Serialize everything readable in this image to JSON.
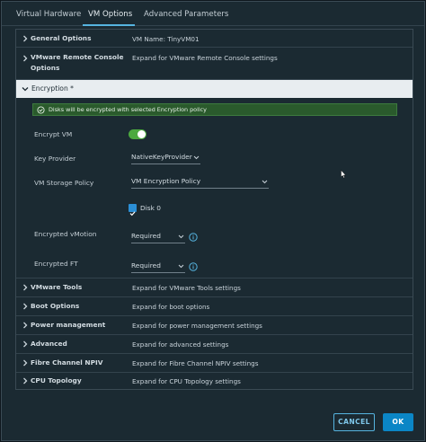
{
  "tabs": [
    {
      "label": "Virtual Hardware"
    },
    {
      "label": "VM Options"
    },
    {
      "label": "Advanced Parameters"
    }
  ],
  "active_tab": "VM Options",
  "colors": {
    "accent": "#56b4e0",
    "toggle_on": "#4ca93f",
    "success_bg": "#2a5a2c",
    "primary_button": "#0b86c6"
  },
  "rows_top": [
    {
      "label": "General Options",
      "value": "VM Name: TinyVM01"
    },
    {
      "label": "VMware Remote Console Options",
      "value": "Expand for VMware Remote Console settings"
    }
  ],
  "encryption": {
    "title": "Encryption *",
    "banner": "Disks will be encrypted with selected Encryption policy",
    "encrypt_vm_label": "Encrypt VM",
    "encrypt_vm_on": true,
    "key_provider_label": "Key Provider",
    "key_provider_value": "NativeKeyProvider",
    "storage_policy_label": "VM Storage Policy",
    "storage_policy_value": "VM Encryption Policy",
    "disk_label": "Disk 0",
    "disk_checked": true,
    "vmotion_label": "Encrypted vMotion",
    "vmotion_value": "Required",
    "ft_label": "Encrypted FT",
    "ft_value": "Required"
  },
  "rows_bottom": [
    {
      "label": "VMware Tools",
      "value": "Expand for VMware Tools settings"
    },
    {
      "label": "Boot Options",
      "value": "Expand for boot options"
    },
    {
      "label": "Power management",
      "value": "Expand for power management settings"
    },
    {
      "label": "Advanced",
      "value": "Expand for advanced settings"
    },
    {
      "label": "Fibre Channel NPIV",
      "value": "Expand for Fibre Channel NPIV settings"
    },
    {
      "label": "CPU Topology",
      "value": "Expand for CPU Topology settings"
    }
  ],
  "buttons": {
    "cancel": "CANCEL",
    "ok": "OK"
  }
}
